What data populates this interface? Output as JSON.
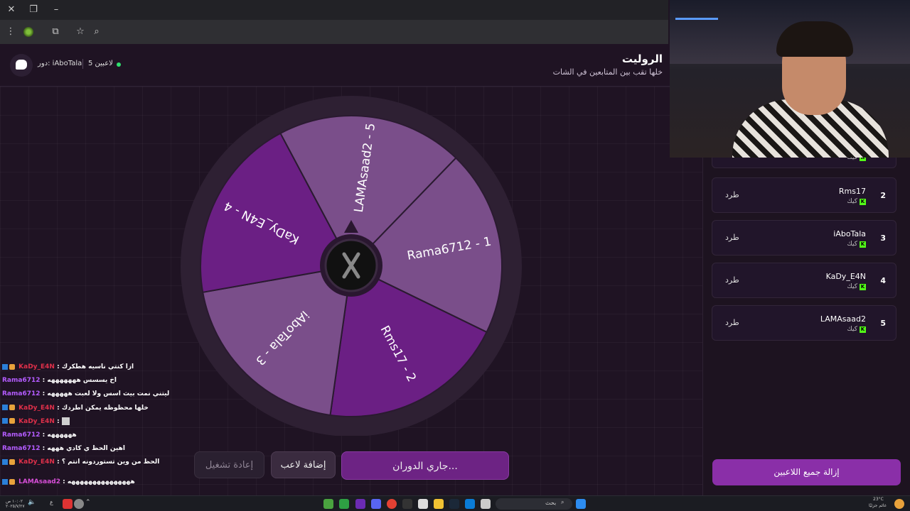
{
  "header": {
    "title": "الروليت",
    "subtitle": "خلها تقب بين المتابعين في الشات",
    "turn_label": "دور: iAboTala",
    "players_count": "5 لاعبين"
  },
  "wheel": {
    "segments": [
      {
        "label": "Rama6712 - 1",
        "color": "#7a4e8a"
      },
      {
        "label": "Rms17 - 2",
        "color": "#6b1f84"
      },
      {
        "label": "iAboTala - 3",
        "color": "#7a4e8a"
      },
      {
        "label": "KaDy_E4N - 4",
        "color": "#6b1f84"
      },
      {
        "label": "LAMAsaad2 - 5",
        "color": "#7a4e8a"
      }
    ]
  },
  "buttons": {
    "spin": "جاري الدوران...",
    "add_player": "إضافة لاعب",
    "restart": "إعادة تشغيل",
    "remove_all": "إزالة جميع اللاعبين"
  },
  "players": [
    {
      "num": "2",
      "name": "Rms17",
      "platform": "كيك",
      "kick": "طرد"
    },
    {
      "num": "3",
      "name": "iAboTala",
      "platform": "كيك",
      "kick": "طرد"
    },
    {
      "num": "4",
      "name": "KaDy_E4N",
      "platform": "كيك",
      "kick": "طرد"
    },
    {
      "num": "5",
      "name": "LAMAsaad2",
      "platform": "كيك",
      "kick": "طرد"
    }
  ],
  "partial_player": {
    "platform": "كيك"
  },
  "chat": [
    {
      "user": "KaDy_E4N",
      "msg": ": ازا كنتي ناسيه هطكرك"
    },
    {
      "user": "Rama6712",
      "msg": ": اخ يسسس هههههههه"
    },
    {
      "user": "Rama6712",
      "msg": ": ليتني نمت بيث اسس ولا لعبت هههههه"
    },
    {
      "user": "KaDy_E4N",
      "msg": ": خلها محظوظه يمكن اطردك"
    },
    {
      "user": "KaDy_E4N",
      "msg": ":"
    },
    {
      "user": "Rama6712",
      "msg": ": ههههههه"
    },
    {
      "user": "Rama6712",
      "msg": ": اهين الحظ ي كادي هههه"
    },
    {
      "user": "KaDy_E4N",
      "msg": ": الحظ من وين تستوردونه انتم ؟"
    },
    {
      "user": "LAMAsaad2",
      "msg": ": هههههههههههههههه"
    }
  ],
  "taskbar": {
    "search": "بحث",
    "temp": "23°C",
    "weather": "غائم جزئيًا",
    "time": "١٠:٠٢ ص",
    "date": "٢٠٢٥/٧/٢٧"
  }
}
